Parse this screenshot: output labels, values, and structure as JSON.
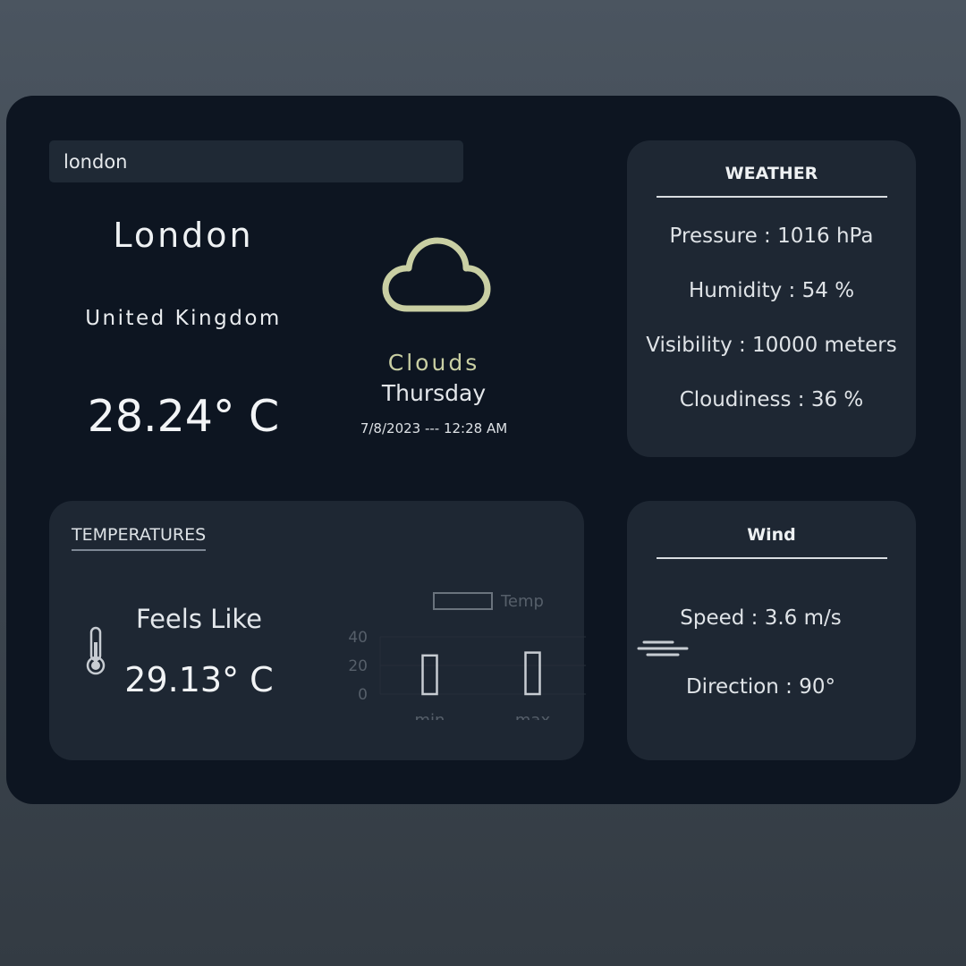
{
  "search": {
    "value": "london"
  },
  "location": {
    "city": "London",
    "country": "United Kingdom"
  },
  "current": {
    "temperature": "28.24° C",
    "condition": "Clouds",
    "day": "Thursday",
    "datetime": "7/8/2023 --- 12:28 AM",
    "icon": "cloud-icon"
  },
  "weather_panel": {
    "title": "WEATHER",
    "pressure": "Pressure : 1016 hPa",
    "humidity": "Humidity : 54 %",
    "visibility": "Visibility : 10000 meters",
    "cloudiness": "Cloudiness : 36 %"
  },
  "temperatures_panel": {
    "title": "TEMPERATURES",
    "feels_like_label": "Feels Like",
    "feels_like_value": "29.13° C",
    "icon": "thermometer-icon"
  },
  "wind_panel": {
    "title": "Wind",
    "speed": "Speed : 3.6 m/s",
    "direction": "Direction : 90°",
    "icon": "wind-icon"
  },
  "colors": {
    "app_bg": "#0d1521",
    "panel_bg": "#1e2733",
    "accent": "#c9cfa3"
  },
  "chart_data": {
    "type": "bar",
    "categories": [
      "min",
      "max"
    ],
    "series": [
      {
        "name": "Temp",
        "values": [
          27,
          29
        ]
      }
    ],
    "yticks": [
      "40",
      "20",
      "0"
    ],
    "ylim": [
      0,
      40
    ],
    "legend": "top"
  }
}
